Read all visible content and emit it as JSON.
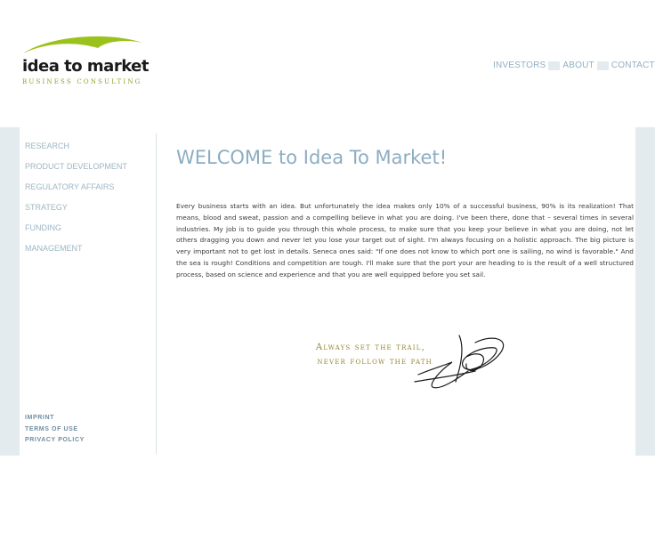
{
  "header": {
    "logo": {
      "title": "idea to market",
      "subtitle": "BUSINESS CONSULTING",
      "swoosh_color": "#9bc21c"
    },
    "nav": [
      {
        "label": "INVESTORS"
      },
      {
        "label": "ABOUT"
      },
      {
        "label": "CONTACT"
      }
    ]
  },
  "sidebar": {
    "items": [
      {
        "label": "RESEARCH"
      },
      {
        "label": "PRODUCT DEVELOPMENT"
      },
      {
        "label": "REGULATORY AFFAIRS"
      },
      {
        "label": "STRATEGY"
      },
      {
        "label": "FUNDING"
      },
      {
        "label": "MANAGEMENT"
      }
    ],
    "footer_links": [
      {
        "label": "IMPRINT"
      },
      {
        "label": "TERMS OF USE"
      },
      {
        "label": "PRIVACY POLICY"
      }
    ]
  },
  "main": {
    "title": "WELCOME to Idea To Market!",
    "intro": "Every business starts with an idea. But unfortunately the idea makes only 10% of a successful business, 90% is its realization! That means, blood and sweat, passion and a compelling believe in what you are doing. I've been there, done that – several times in several industries. My job is to guide you through this whole process, to make sure that you keep your believe in what you are doing, not let others dragging you down and never let you lose your target out of sight. I'm always focusing on a holistic approach. The big picture is very important not to get lost in details. Seneca ones said: \"If one does not know to which port one is sailing, no wind is favorable.\" And the sea is rough! Conditions and competition are tough. I'll make sure that the port your are heading to is the result of a well structured process, based on science and experience and that you are well equipped before you set sail.",
    "motto": {
      "line1": "Always set the trail,",
      "line2": "never follow the path"
    }
  },
  "colors": {
    "accent_blue": "#8cadc2",
    "nav_text": "#8fb0c3",
    "frame_bg": "#e4ebef",
    "logo_green": "#9bc21c",
    "motto_gold": "#9a8430"
  }
}
